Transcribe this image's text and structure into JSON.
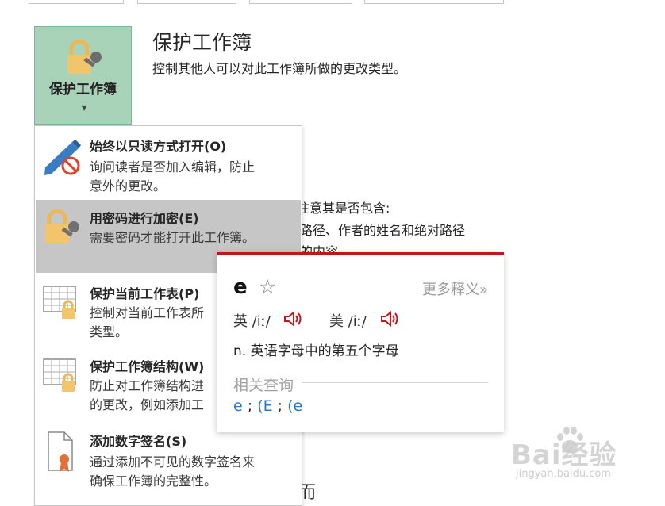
{
  "section": {
    "button_label": "保护工作簿",
    "title": "保护工作簿",
    "description": "控制其他人可以对此工作簿所做的更改类型。"
  },
  "background_text": {
    "line1": "注意其是否包含:",
    "line2": "路径、作者的姓名和绝对路径",
    "line3": "的内容",
    "line4": "而"
  },
  "menu": {
    "items": [
      {
        "title": "始终以只读方式打开(O)",
        "desc": [
          "询问读者是否加入编辑，防止",
          "意外的更改。"
        ],
        "icon": "pencil-no-edit-icon"
      },
      {
        "title": "用密码进行加密(E)",
        "desc": [
          "需要密码才能打开此工作簿。"
        ],
        "icon": "lock-key-icon"
      },
      {
        "title": "保护当前工作表(P)",
        "desc": [
          "控制对当前工作表所",
          "类型。"
        ],
        "icon": "sheet-lock-icon"
      },
      {
        "title": "保护工作簿结构(W)",
        "desc": [
          "防止对工作簿结构进",
          "的更改，例如添加工"
        ],
        "icon": "workbook-lock-icon"
      },
      {
        "title": "添加数字签名(S)",
        "desc": [
          "通过添加不可见的数字签名来",
          "确保工作簿的完整性。"
        ],
        "icon": "signature-ribbon-icon"
      }
    ]
  },
  "dict": {
    "word": "e",
    "star": "☆",
    "more": "更多释义»",
    "uk_label": "英",
    "uk_phonetic": "/iː/",
    "us_label": "美",
    "us_phonetic": "/iː/",
    "definition": "n. 英语字母中的第五个字母",
    "related_title": "相关查询",
    "related": [
      "e",
      "(E",
      "(e"
    ],
    "accent_color": "#c0171b"
  },
  "watermark": {
    "brand": "Bai经验",
    "url": "jingyan.baidu.com"
  }
}
